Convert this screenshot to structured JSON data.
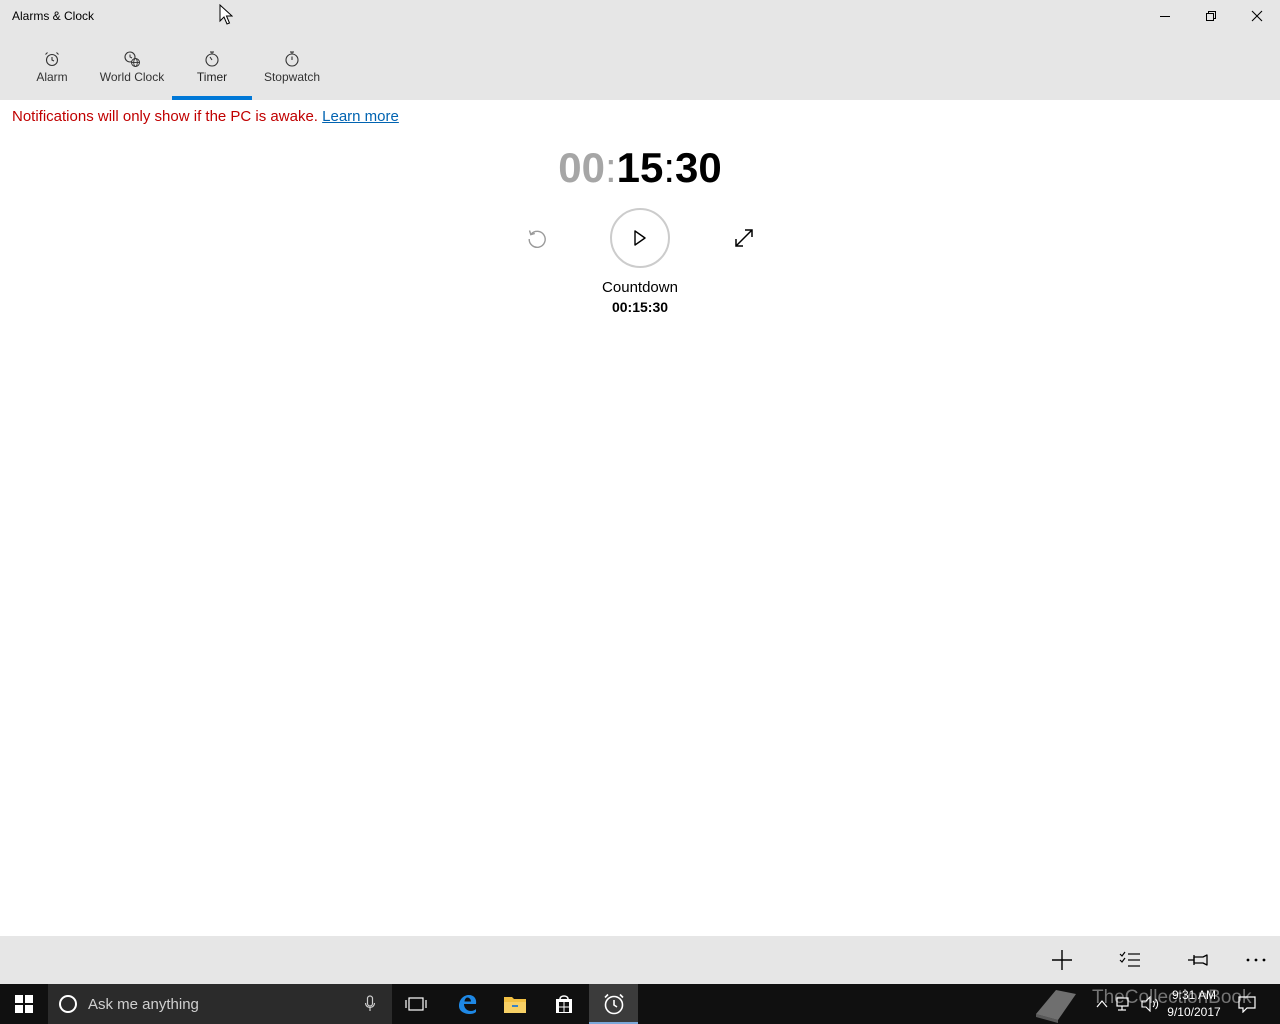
{
  "window": {
    "title": "Alarms & Clock"
  },
  "tabs": [
    {
      "label": "Alarm",
      "icon": "alarm-clock-icon"
    },
    {
      "label": "World Clock",
      "icon": "world-clock-icon"
    },
    {
      "label": "Timer",
      "icon": "timer-icon",
      "selected": true
    },
    {
      "label": "Stopwatch",
      "icon": "stopwatch-icon"
    }
  ],
  "notice": {
    "text": "Notifications will only show if the PC is awake.",
    "link": "Learn more"
  },
  "timer": {
    "hours": "00",
    "minutes": "15",
    "seconds": "30",
    "name": "Countdown",
    "small_hours": "00",
    "small_minutes": "15",
    "small_seconds": "30"
  },
  "commandbar": {
    "icons": [
      "add-icon",
      "select-list-icon",
      "pin-icon",
      "more-icon"
    ]
  },
  "taskbar": {
    "search_placeholder": "Ask me anything",
    "clock_time": "9:31 AM",
    "clock_date": "9/10/2017",
    "watermark": "TheCollectionBook"
  },
  "colors": {
    "accent": "#0078d7",
    "notice": "#c00000",
    "link": "#0063b1",
    "chrome": "#e6e6e6",
    "taskbar": "#101010"
  }
}
